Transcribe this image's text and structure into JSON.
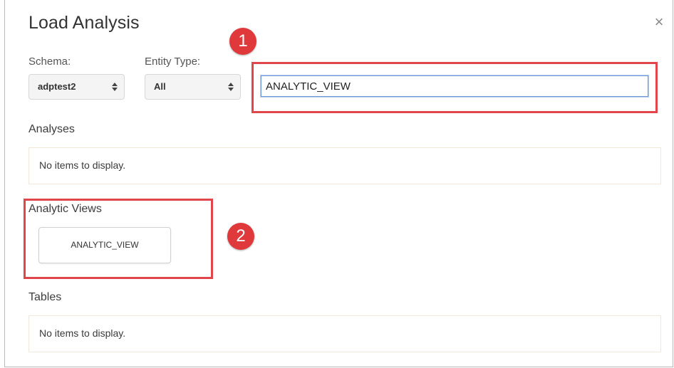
{
  "dialog": {
    "title": "Load Analysis",
    "close_symbol": "×"
  },
  "filters": {
    "schema_label": "Schema:",
    "schema_value": "adptest2",
    "entity_type_label": "Entity Type:",
    "entity_type_value": "All"
  },
  "search": {
    "value": "ANALYTIC_VIEW"
  },
  "annotations": {
    "badge_1": "1",
    "badge_2": "2",
    "color": "#e0454a"
  },
  "sections": {
    "analyses": {
      "title": "Analyses",
      "empty_text": "No items to display."
    },
    "analytic_views": {
      "title": "Analytic Views",
      "items": [
        "ANALYTIC_VIEW"
      ]
    },
    "tables": {
      "title": "Tables",
      "empty_text": "No items to display."
    }
  },
  "icons": {
    "close": "close-icon",
    "select_arrows": "sort-arrows-icon"
  }
}
